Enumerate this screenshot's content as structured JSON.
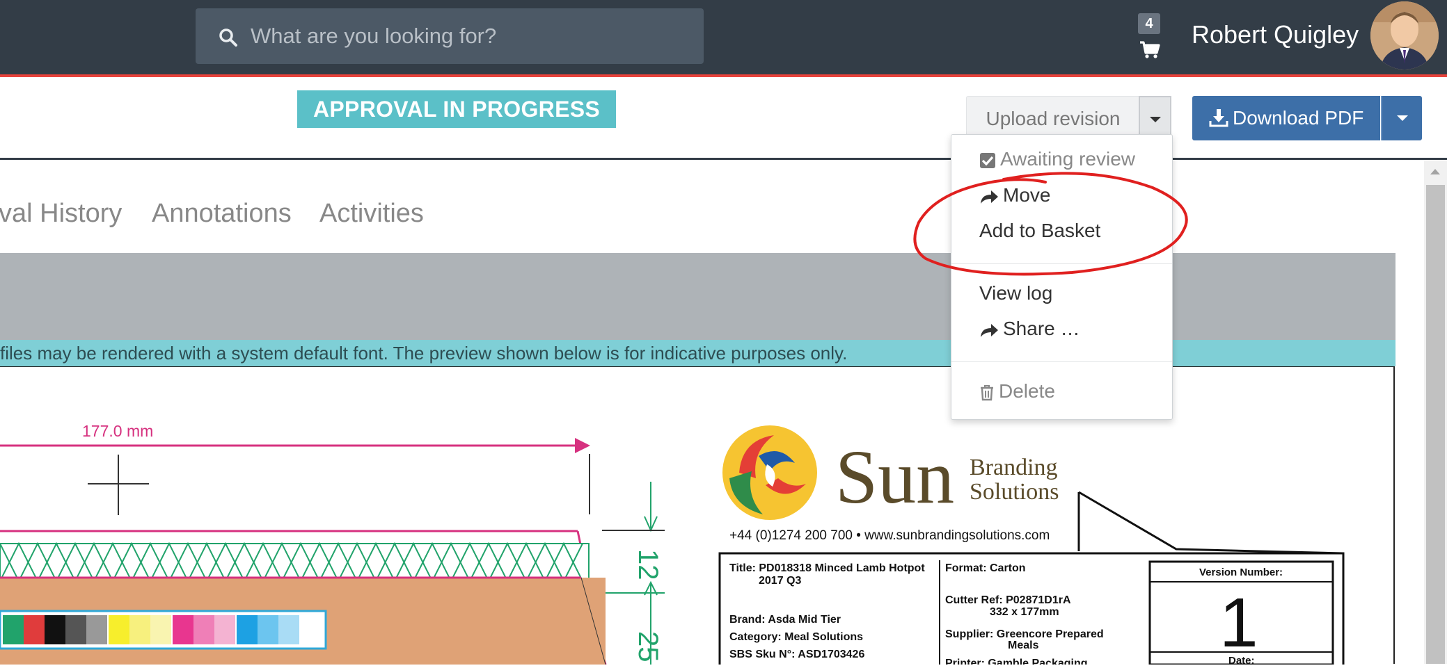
{
  "header": {
    "search_placeholder": "What are you looking for?",
    "cart_count": "4",
    "user_name": "Robert Quigley"
  },
  "toolbar": {
    "status_label": "APPROVAL IN PROGRESS",
    "upload_label": "Upload revision",
    "download_label": "Download PDF"
  },
  "tabs": [
    "val History",
    "Annotations",
    "Activities"
  ],
  "info_text": "files may be rendered with a system default font. The preview shown below is for indicative purposes only.",
  "menu": {
    "awaiting": "Awaiting review",
    "move": "Move",
    "add_basket": "Add to Basket",
    "view_log": "View log",
    "share": "Share …",
    "delete": "Delete"
  },
  "artwork": {
    "dimension": "177.0 mm",
    "dim_12": "12",
    "dim_25": "25",
    "brand_sun": "Sun",
    "brand_branding": "Branding",
    "brand_solutions": "Solutions",
    "contact": "+44 (0)1274 200 700 • www.sunbrandingsolutions.com",
    "title_line1": "Title: PD018318 Minced Lamb Hotpot",
    "title_line2": "2017 Q3",
    "brand_line": "Brand: Asda Mid Tier",
    "category_line": "Category: Meal Solutions",
    "sku_line": "SBS Sku N°: ASD1703426",
    "format_line": "Format: Carton",
    "cutter_line1": "Cutter Ref: P02871D1rA",
    "cutter_line2": "332 x 177mm",
    "supplier_line1": "Supplier: Greencore Prepared",
    "supplier_line2": "Meals",
    "printer_line": "Printer: Gamble Packaging",
    "version_label": "Version Number:",
    "version_value": "1",
    "date_label": "Date:"
  },
  "colors": {
    "topbar": "#333d47",
    "accent_red": "#e8423b",
    "status_teal": "#5bc0c8",
    "download_blue": "#3d6fa8",
    "info_teal": "#7fcfd6",
    "annotation_red": "#e0201f"
  },
  "icons": [
    "search-icon",
    "cart-icon",
    "caret-down-icon",
    "download-icon",
    "checkbox-icon",
    "share-arrow-icon",
    "trash-icon"
  ]
}
